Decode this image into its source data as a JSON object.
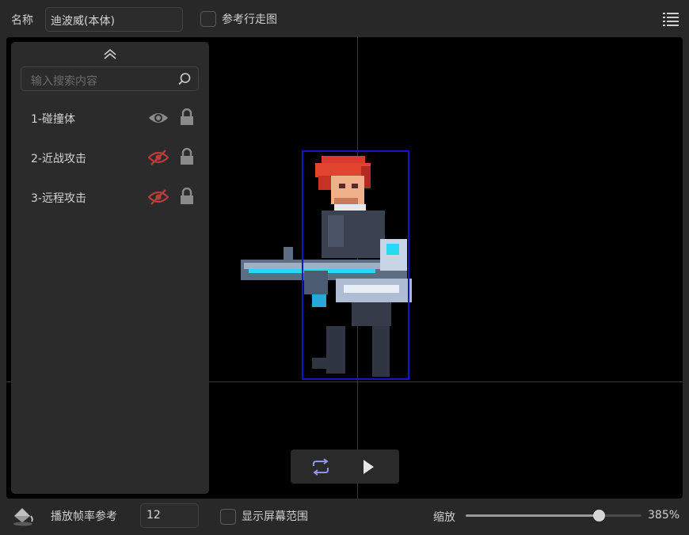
{
  "header": {
    "name_label": "名称",
    "name_value": "迪波威(本体)",
    "ref_walk_label": "参考行走图",
    "ref_walk_checked": false,
    "list_icon": "list-icon"
  },
  "layers_panel": {
    "collapse_icon": "double-chevron-up-icon",
    "search_placeholder": "输入搜索内容",
    "items": [
      {
        "label": "1-碰撞体",
        "visible": true,
        "locked": true
      },
      {
        "label": "2-近战攻击",
        "visible": false,
        "locked": true
      },
      {
        "label": "3-远程攻击",
        "visible": false,
        "locked": true
      }
    ]
  },
  "colors": {
    "hidden_red": "#c0393b",
    "visible_gray": "#8a8a8a",
    "hitbox_blue": "#1414c8",
    "loop_blue": "#8f95e6"
  },
  "playback": {
    "loop_icon": "loop-icon",
    "play_icon": "play-icon"
  },
  "footer": {
    "bucket_icon": "paint-bucket-icon",
    "fps_label": "播放帧率参考",
    "fps_value": "12",
    "show_screen_label": "显示屏幕范围",
    "show_screen_checked": false,
    "zoom_label": "缩放",
    "zoom_value": "385%",
    "zoom_fraction": 0.755
  }
}
